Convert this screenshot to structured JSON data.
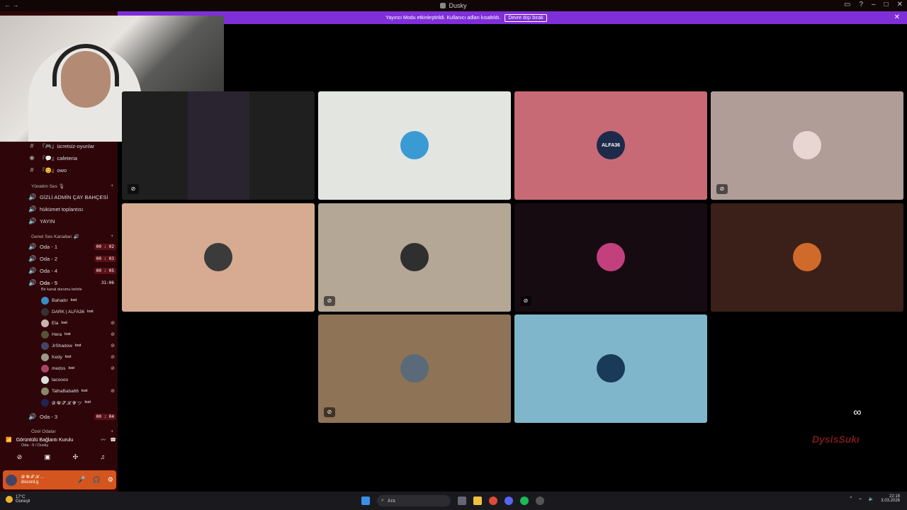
{
  "app": {
    "title": "Dusky"
  },
  "notice": {
    "text": "Yayıncı Modu etkinleştirildi. Kullanıcı adları kısaltıldı.",
    "button": "Devre dışı bırak"
  },
  "channels_top": [
    {
      "name": "『🎮』ücretsiz-oyunlar"
    },
    {
      "name": "『💬』cafeteria"
    },
    {
      "name": "『😊』owo"
    }
  ],
  "categories": {
    "yonetim": "Yönetim Ses 🎙",
    "genel": "Genel Ses Kanalları 🔊",
    "ozel": "Özel Odalar"
  },
  "voice_yonetim": [
    "GİZLİ ADMİN ÇAY BAHÇESİ",
    "hükümet toplantısı",
    "YAYIN"
  ],
  "voice_genel": [
    {
      "name": "Oda - 1",
      "time": "00 : 02"
    },
    {
      "name": "Oda - 2",
      "time": "00 : 03"
    },
    {
      "name": "Oda - 4",
      "time": "00 : 05"
    },
    {
      "name": "Oda - 5",
      "time": "31:06"
    },
    {
      "name": "Oda - 3",
      "time": "00 : 04"
    }
  ],
  "oda5_status": "Bir kanal durumu belirle",
  "oda5_users": [
    {
      "name": "Bahadır",
      "tag": "lost",
      "color": "#3a8cc4"
    },
    {
      "name": "DARK | ALFA36",
      "tag": "lost",
      "color": "#333"
    },
    {
      "name": "Ela",
      "tag": "lost",
      "color": "#c9b4ae"
    },
    {
      "name": "Hera",
      "tag": "lost",
      "color": "#553"
    },
    {
      "name": "JrShadow",
      "tag": "lost",
      "color": "#446"
    },
    {
      "name": "Kedy",
      "tag": "lost",
      "color": "#998"
    },
    {
      "name": "medos",
      "tag": "lost",
      "color": "#a46"
    },
    {
      "name": "tacoooo",
      "tag": "",
      "color": "#ddd"
    },
    {
      "name": "TalhaBaba66",
      "tag": "lost",
      "color": "#886"
    },
    {
      "name": "𝓓 𝓤 𝓢 𝓚 𝓨 ツ",
      "tag": "lost",
      "color": "#225"
    }
  ],
  "voice_connection": {
    "title": "Görüntülü Bağlantı Kurulu",
    "sub": "Oda - 5 / Dusky"
  },
  "user_panel": {
    "name": "𝓓 𝓤 𝓢 𝓚 ...",
    "sub": "discord.g"
  },
  "tiles": [
    {
      "bg": "#e2e5e0",
      "avatar": "#3a9ad4",
      "muted": false
    },
    {
      "bg": "#c76a76",
      "avatar": "#1d2a4a",
      "label": "ALFA36",
      "muted": false
    },
    {
      "bg": "#b09d97",
      "avatar": "#e8d6d2",
      "muted": true
    },
    {
      "bg": "#d7ab91",
      "avatar": "#3b3b3b",
      "muted": false
    },
    {
      "bg": "#b4a796",
      "avatar": "#2f2f2f",
      "muted": true
    },
    {
      "bg": "#170b12",
      "avatar": "#c2417d",
      "muted": true
    },
    {
      "bg": "#3a2018",
      "avatar": "#d06a2a",
      "muted": false
    },
    {
      "bg": "#8e7356",
      "avatar": "#5a6a78",
      "muted": true
    },
    {
      "bg": "#7fb6cb",
      "avatar": "#1a3a5a",
      "muted": false
    }
  ],
  "watermark": "DysisSukı",
  "taskbar": {
    "weather": "17°C",
    "weather_sub": "Güneşli",
    "search": "Ara",
    "time": "22:18",
    "date": "3.03.2026"
  }
}
